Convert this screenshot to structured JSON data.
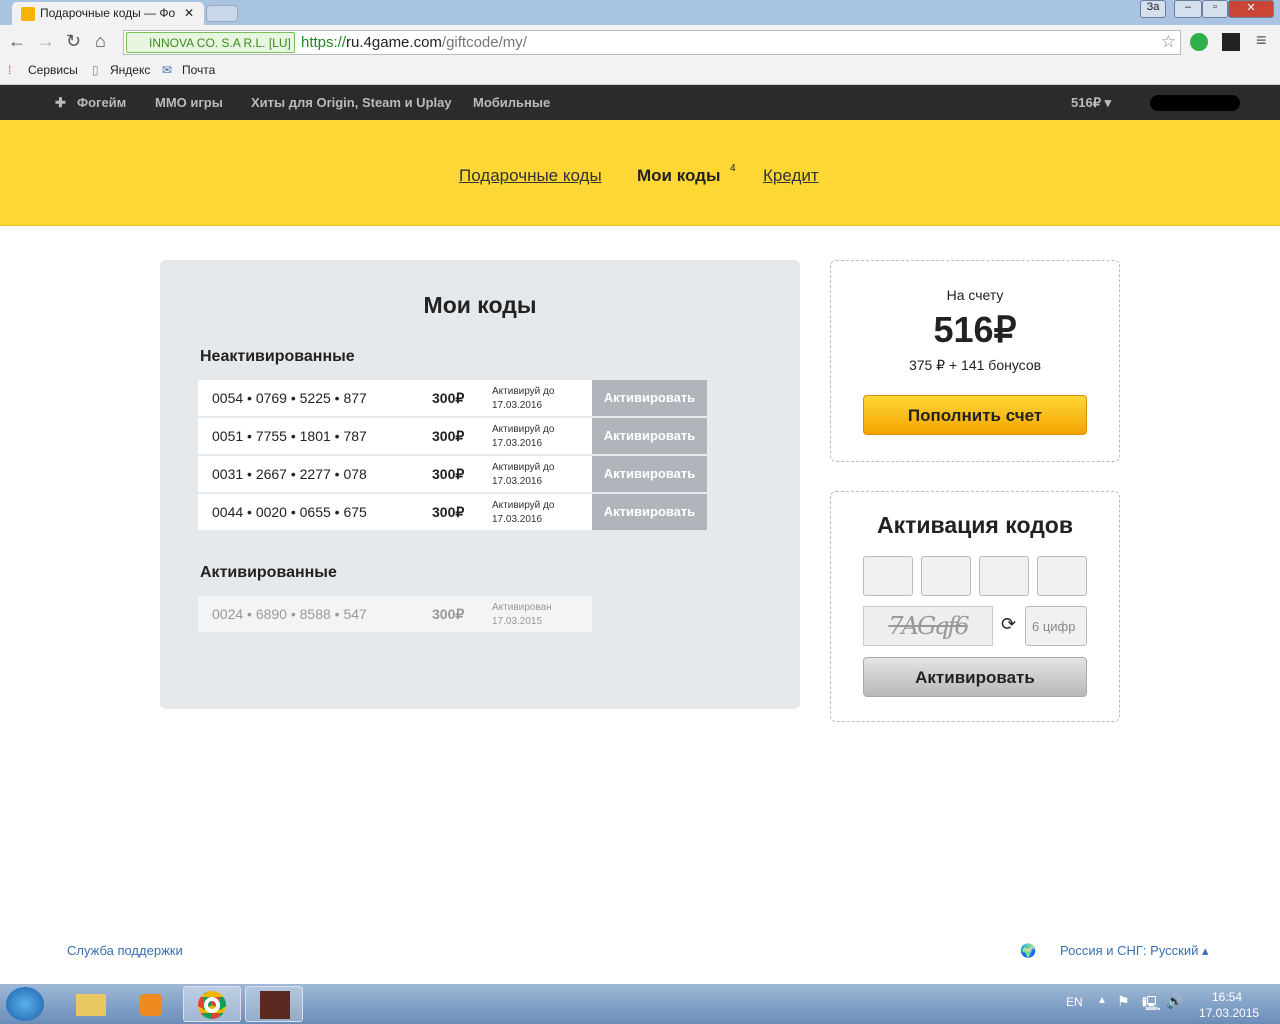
{
  "browser": {
    "tab_title": "Подарочные коды — Фо",
    "ev_label": "INNOVA CO. S.A R.L. [LU]",
    "url_scheme": "https://",
    "url_host": "ru.4game.com",
    "url_path": "/giftcode/my/",
    "bookmarks": [
      "Сервисы",
      "Яндекс",
      "Почта"
    ],
    "win_label": "За"
  },
  "sitenav": {
    "items": [
      "Фогейм",
      "MMO игры",
      "Хиты для Origin, Steam и Uplay",
      "Мобильные"
    ],
    "balance": "516₽ ▾"
  },
  "subnav": {
    "gift": "Подарочные коды",
    "my": "Мои коды",
    "my_count": "4",
    "credit": "Кредит"
  },
  "codes": {
    "title": "Мои коды",
    "inactive_heading": "Неактивированные",
    "active_heading": "Активированные",
    "inactive": [
      {
        "code": "0054 • 0769 • 5225 • 877",
        "amount": "300₽",
        "exp1": "Активируй до",
        "exp2": "17.03.2016",
        "button": "Активировать"
      },
      {
        "code": "0051 • 7755 • 1801 • 787",
        "amount": "300₽",
        "exp1": "Активируй до",
        "exp2": "17.03.2016",
        "button": "Активировать"
      },
      {
        "code": "0031 • 2667 • 2277 • 078",
        "amount": "300₽",
        "exp1": "Активируй до",
        "exp2": "17.03.2016",
        "button": "Активировать"
      },
      {
        "code": "0044 • 0020 • 0655 • 675",
        "amount": "300₽",
        "exp1": "Активируй до",
        "exp2": "17.03.2016",
        "button": "Активировать"
      }
    ],
    "active": [
      {
        "code": "0024 • 6890 • 8588 • 547",
        "amount": "300₽",
        "exp1": "Активирован",
        "exp2": "17.03.2015"
      }
    ]
  },
  "account": {
    "label": "На счету",
    "total": "516₽",
    "breakdown": "375 ₽  + 141 бонусов",
    "topup": "Пополнить счет"
  },
  "activation": {
    "title": "Активация кодов",
    "captcha_placeholder": "6 цифр",
    "captcha_text": "7AGqf6",
    "button": "Активировать"
  },
  "footer": {
    "support": "Служба поддержки",
    "region": "Россия и СНГ: Русский ▴"
  },
  "taskbar": {
    "lang": "EN",
    "time": "16:54",
    "date": "17.03.2015"
  }
}
